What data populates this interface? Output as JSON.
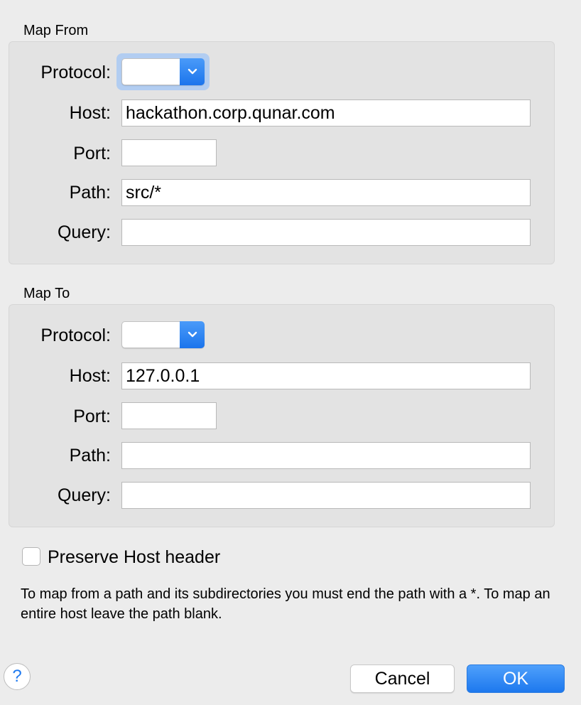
{
  "map_from": {
    "title": "Map From",
    "protocol_label": "Protocol:",
    "protocol_value": "",
    "host_label": "Host:",
    "host_value": "hackathon.corp.qunar.com",
    "port_label": "Port:",
    "port_value": "",
    "path_label": "Path:",
    "path_value": "src/*",
    "query_label": "Query:",
    "query_value": ""
  },
  "map_to": {
    "title": "Map To",
    "protocol_label": "Protocol:",
    "protocol_value": "",
    "host_label": "Host:",
    "host_value": "127.0.0.1",
    "port_label": "Port:",
    "port_value": "",
    "path_label": "Path:",
    "path_value": "",
    "query_label": "Query:",
    "query_value": ""
  },
  "preserve_host": {
    "label": "Preserve Host header",
    "checked": false
  },
  "hint": "To map from a path and its subdirectories you must end the path with a *. To map an entire host leave the path blank.",
  "buttons": {
    "help": "?",
    "cancel": "Cancel",
    "ok": "OK"
  },
  "icons": {
    "select_chevron": "chevron-down-icon",
    "help": "help-icon"
  },
  "colors": {
    "accent": "#1b74ec",
    "background": "#ececec",
    "panel": "#e3e3e3"
  }
}
